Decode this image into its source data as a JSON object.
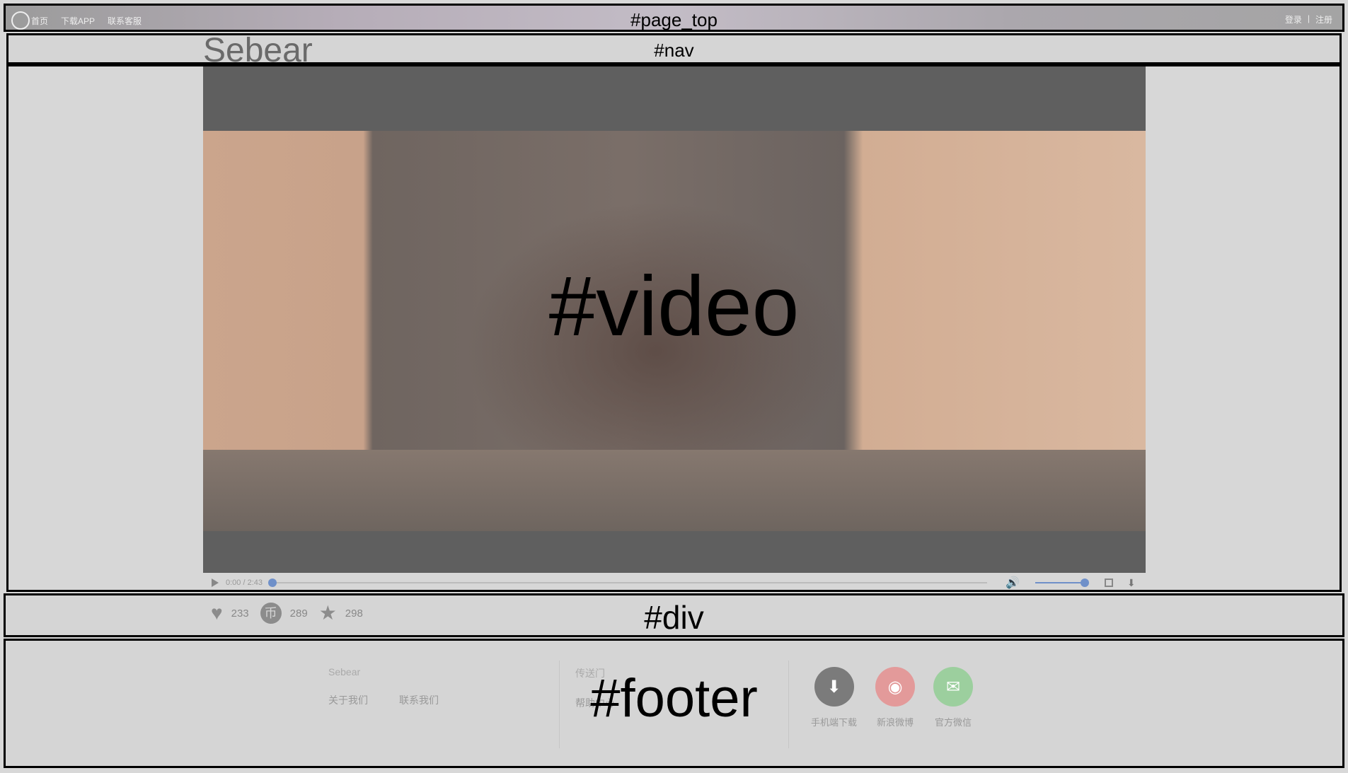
{
  "page_top": {
    "tag": "#page_top",
    "left_links": [
      "首页",
      "下载APP",
      "联系客服"
    ],
    "login": "登录",
    "separator": "|",
    "register": "注册"
  },
  "nav": {
    "logo": "Sebear",
    "tag": "#nav"
  },
  "video": {
    "tag": "#video",
    "time": "0:00 / 2:43",
    "progress": 0,
    "volume": 1
  },
  "div": {
    "tag": "#div",
    "likes": "233",
    "coins": "289",
    "favorites": "298"
  },
  "footer": {
    "tag": "#footer",
    "brand": "Sebear",
    "about": "关于我们",
    "contact": "联系我们",
    "portal": "传送门",
    "help": "帮助中心",
    "apps": [
      {
        "label": "手机端下载",
        "icon": "download-icon",
        "color": "#7b7b7b"
      },
      {
        "label": "新浪微博",
        "icon": "weibo-icon",
        "color": "#e39a9a"
      },
      {
        "label": "官方微信",
        "icon": "wechat-icon",
        "color": "#9ccf9e"
      }
    ]
  }
}
